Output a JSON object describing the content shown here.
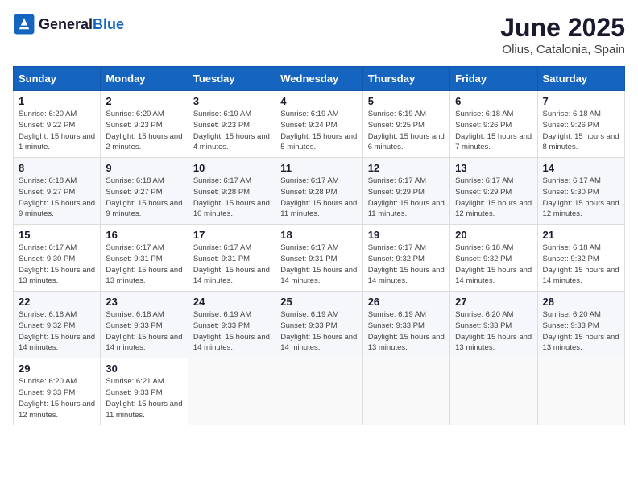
{
  "logo": {
    "general": "General",
    "blue": "Blue"
  },
  "header": {
    "month": "June 2025",
    "location": "Olius, Catalonia, Spain"
  },
  "weekdays": [
    "Sunday",
    "Monday",
    "Tuesday",
    "Wednesday",
    "Thursday",
    "Friday",
    "Saturday"
  ],
  "weeks": [
    [
      {
        "day": "1",
        "sunrise": "Sunrise: 6:20 AM",
        "sunset": "Sunset: 9:22 PM",
        "daylight": "Daylight: 15 hours and 1 minute."
      },
      {
        "day": "2",
        "sunrise": "Sunrise: 6:20 AM",
        "sunset": "Sunset: 9:23 PM",
        "daylight": "Daylight: 15 hours and 2 minutes."
      },
      {
        "day": "3",
        "sunrise": "Sunrise: 6:19 AM",
        "sunset": "Sunset: 9:23 PM",
        "daylight": "Daylight: 15 hours and 4 minutes."
      },
      {
        "day": "4",
        "sunrise": "Sunrise: 6:19 AM",
        "sunset": "Sunset: 9:24 PM",
        "daylight": "Daylight: 15 hours and 5 minutes."
      },
      {
        "day": "5",
        "sunrise": "Sunrise: 6:19 AM",
        "sunset": "Sunset: 9:25 PM",
        "daylight": "Daylight: 15 hours and 6 minutes."
      },
      {
        "day": "6",
        "sunrise": "Sunrise: 6:18 AM",
        "sunset": "Sunset: 9:26 PM",
        "daylight": "Daylight: 15 hours and 7 minutes."
      },
      {
        "day": "7",
        "sunrise": "Sunrise: 6:18 AM",
        "sunset": "Sunset: 9:26 PM",
        "daylight": "Daylight: 15 hours and 8 minutes."
      }
    ],
    [
      {
        "day": "8",
        "sunrise": "Sunrise: 6:18 AM",
        "sunset": "Sunset: 9:27 PM",
        "daylight": "Daylight: 15 hours and 9 minutes."
      },
      {
        "day": "9",
        "sunrise": "Sunrise: 6:18 AM",
        "sunset": "Sunset: 9:27 PM",
        "daylight": "Daylight: 15 hours and 9 minutes."
      },
      {
        "day": "10",
        "sunrise": "Sunrise: 6:17 AM",
        "sunset": "Sunset: 9:28 PM",
        "daylight": "Daylight: 15 hours and 10 minutes."
      },
      {
        "day": "11",
        "sunrise": "Sunrise: 6:17 AM",
        "sunset": "Sunset: 9:28 PM",
        "daylight": "Daylight: 15 hours and 11 minutes."
      },
      {
        "day": "12",
        "sunrise": "Sunrise: 6:17 AM",
        "sunset": "Sunset: 9:29 PM",
        "daylight": "Daylight: 15 hours and 11 minutes."
      },
      {
        "day": "13",
        "sunrise": "Sunrise: 6:17 AM",
        "sunset": "Sunset: 9:29 PM",
        "daylight": "Daylight: 15 hours and 12 minutes."
      },
      {
        "day": "14",
        "sunrise": "Sunrise: 6:17 AM",
        "sunset": "Sunset: 9:30 PM",
        "daylight": "Daylight: 15 hours and 12 minutes."
      }
    ],
    [
      {
        "day": "15",
        "sunrise": "Sunrise: 6:17 AM",
        "sunset": "Sunset: 9:30 PM",
        "daylight": "Daylight: 15 hours and 13 minutes."
      },
      {
        "day": "16",
        "sunrise": "Sunrise: 6:17 AM",
        "sunset": "Sunset: 9:31 PM",
        "daylight": "Daylight: 15 hours and 13 minutes."
      },
      {
        "day": "17",
        "sunrise": "Sunrise: 6:17 AM",
        "sunset": "Sunset: 9:31 PM",
        "daylight": "Daylight: 15 hours and 14 minutes."
      },
      {
        "day": "18",
        "sunrise": "Sunrise: 6:17 AM",
        "sunset": "Sunset: 9:31 PM",
        "daylight": "Daylight: 15 hours and 14 minutes."
      },
      {
        "day": "19",
        "sunrise": "Sunrise: 6:17 AM",
        "sunset": "Sunset: 9:32 PM",
        "daylight": "Daylight: 15 hours and 14 minutes."
      },
      {
        "day": "20",
        "sunrise": "Sunrise: 6:18 AM",
        "sunset": "Sunset: 9:32 PM",
        "daylight": "Daylight: 15 hours and 14 minutes."
      },
      {
        "day": "21",
        "sunrise": "Sunrise: 6:18 AM",
        "sunset": "Sunset: 9:32 PM",
        "daylight": "Daylight: 15 hours and 14 minutes."
      }
    ],
    [
      {
        "day": "22",
        "sunrise": "Sunrise: 6:18 AM",
        "sunset": "Sunset: 9:32 PM",
        "daylight": "Daylight: 15 hours and 14 minutes."
      },
      {
        "day": "23",
        "sunrise": "Sunrise: 6:18 AM",
        "sunset": "Sunset: 9:33 PM",
        "daylight": "Daylight: 15 hours and 14 minutes."
      },
      {
        "day": "24",
        "sunrise": "Sunrise: 6:19 AM",
        "sunset": "Sunset: 9:33 PM",
        "daylight": "Daylight: 15 hours and 14 minutes."
      },
      {
        "day": "25",
        "sunrise": "Sunrise: 6:19 AM",
        "sunset": "Sunset: 9:33 PM",
        "daylight": "Daylight: 15 hours and 14 minutes."
      },
      {
        "day": "26",
        "sunrise": "Sunrise: 6:19 AM",
        "sunset": "Sunset: 9:33 PM",
        "daylight": "Daylight: 15 hours and 13 minutes."
      },
      {
        "day": "27",
        "sunrise": "Sunrise: 6:20 AM",
        "sunset": "Sunset: 9:33 PM",
        "daylight": "Daylight: 15 hours and 13 minutes."
      },
      {
        "day": "28",
        "sunrise": "Sunrise: 6:20 AM",
        "sunset": "Sunset: 9:33 PM",
        "daylight": "Daylight: 15 hours and 13 minutes."
      }
    ],
    [
      {
        "day": "29",
        "sunrise": "Sunrise: 6:20 AM",
        "sunset": "Sunset: 9:33 PM",
        "daylight": "Daylight: 15 hours and 12 minutes."
      },
      {
        "day": "30",
        "sunrise": "Sunrise: 6:21 AM",
        "sunset": "Sunset: 9:33 PM",
        "daylight": "Daylight: 15 hours and 11 minutes."
      },
      null,
      null,
      null,
      null,
      null
    ]
  ]
}
